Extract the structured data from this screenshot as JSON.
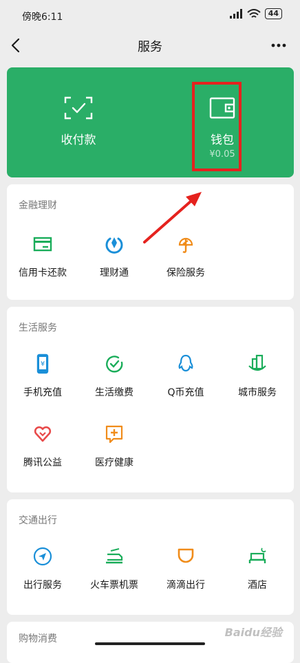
{
  "status_bar": {
    "time": "傍晚6:11",
    "battery": "44"
  },
  "nav": {
    "title": "服务"
  },
  "hero": {
    "pay": {
      "label": "收付款"
    },
    "wallet": {
      "label": "钱包",
      "amount": "¥0.05"
    }
  },
  "sections": {
    "finance": {
      "title": "金融理财",
      "items": [
        {
          "label": "信用卡还款",
          "icon": "credit-card-icon"
        },
        {
          "label": "理财通",
          "icon": "wealth-icon"
        },
        {
          "label": "保险服务",
          "icon": "insurance-icon"
        }
      ]
    },
    "life": {
      "title": "生活服务",
      "items": [
        {
          "label": "手机充值",
          "icon": "phone-icon"
        },
        {
          "label": "生活缴费",
          "icon": "bill-icon"
        },
        {
          "label": "Q币充值",
          "icon": "qq-icon"
        },
        {
          "label": "城市服务",
          "icon": "city-icon"
        },
        {
          "label": "腾讯公益",
          "icon": "charity-icon"
        },
        {
          "label": "医疗健康",
          "icon": "medical-icon"
        }
      ]
    },
    "travel": {
      "title": "交通出行",
      "items": [
        {
          "label": "出行服务",
          "icon": "navigation-icon"
        },
        {
          "label": "火车票机票",
          "icon": "train-icon"
        },
        {
          "label": "滴滴出行",
          "icon": "didi-icon"
        },
        {
          "label": "酒店",
          "icon": "hotel-icon"
        }
      ]
    },
    "shopping": {
      "title": "购物消费"
    }
  },
  "watermark": "Baidu经验",
  "colors": {
    "brand_green": "#2aae67",
    "highlight_red": "#e5221e",
    "background": "#ededed"
  }
}
